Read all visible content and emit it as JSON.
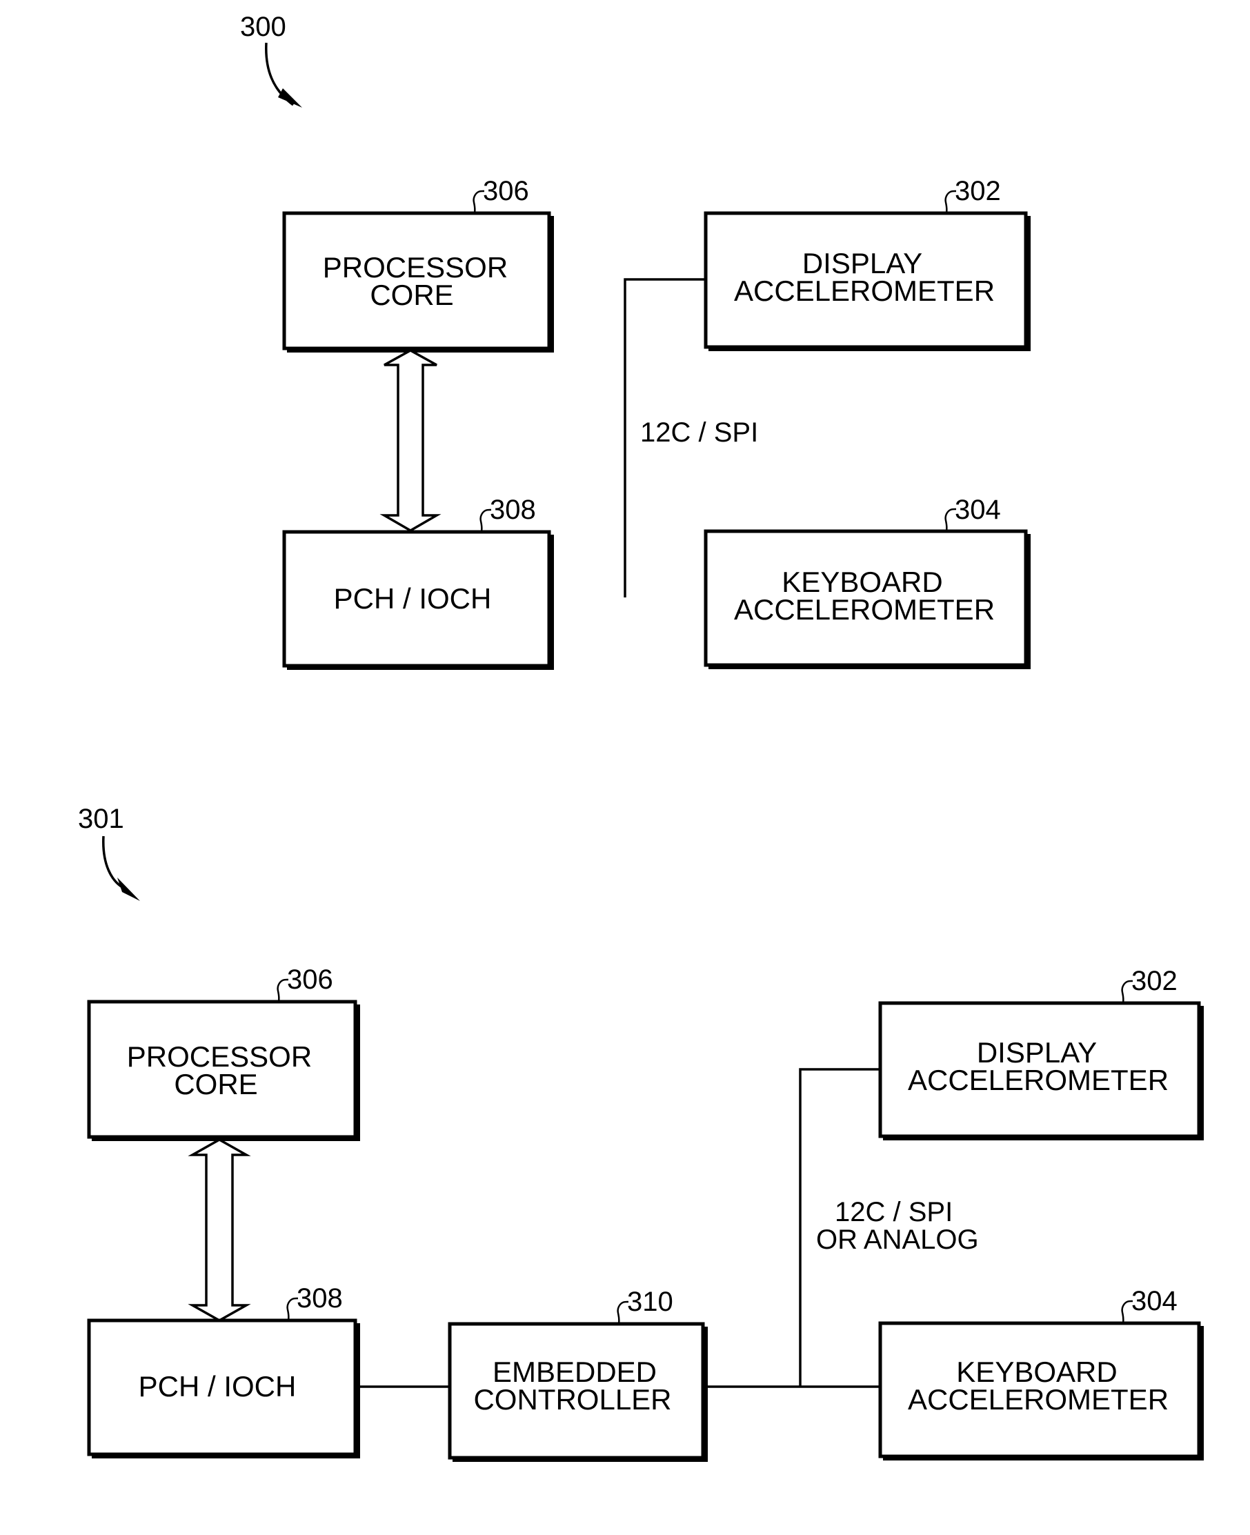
{
  "figures": [
    {
      "ref": "300",
      "bus_label": [
        "12C / SPI"
      ],
      "blocks": {
        "processor_core": {
          "ref": "306",
          "lines": [
            "PROCESSOR",
            "CORE"
          ]
        },
        "pch_ioch": {
          "ref": "308",
          "lines": [
            "PCH / IOCH"
          ]
        },
        "display_accel": {
          "ref": "302",
          "lines": [
            "DISPLAY",
            "ACCELEROMETER"
          ]
        },
        "keyboard_accel": {
          "ref": "304",
          "lines": [
            "KEYBOARD",
            "ACCELEROMETER"
          ]
        }
      }
    },
    {
      "ref": "301",
      "bus_label": [
        "12C / SPI",
        "OR ANALOG"
      ],
      "blocks": {
        "processor_core": {
          "ref": "306",
          "lines": [
            "PROCESSOR",
            "CORE"
          ]
        },
        "pch_ioch": {
          "ref": "308",
          "lines": [
            "PCH / IOCH"
          ]
        },
        "embedded_controller": {
          "ref": "310",
          "lines": [
            "EMBEDDED",
            "CONTROLLER"
          ]
        },
        "display_accel": {
          "ref": "302",
          "lines": [
            "DISPLAY",
            "ACCELEROMETER"
          ]
        },
        "keyboard_accel": {
          "ref": "304",
          "lines": [
            "KEYBOARD",
            "ACCELEROMETER"
          ]
        }
      }
    }
  ]
}
